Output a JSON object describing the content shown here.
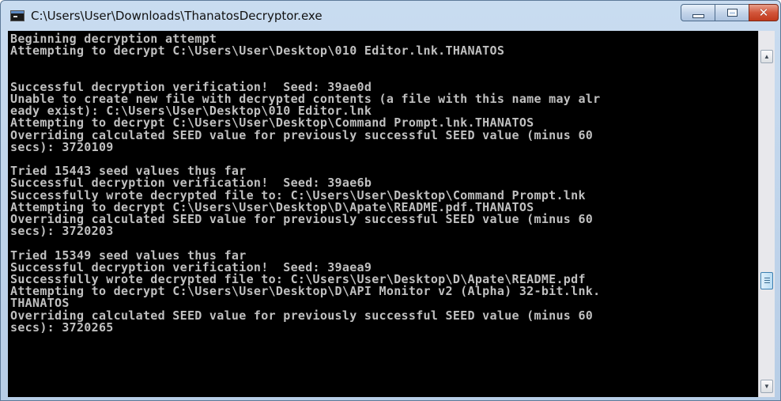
{
  "window": {
    "title": "C:\\Users\\User\\Downloads\\ThanatosDecryptor.exe",
    "icon": "console-app-icon",
    "controls": {
      "minimize": "minimize-icon",
      "maximize": "maximize-icon",
      "close": "✕"
    }
  },
  "console": {
    "background": "#000000",
    "foreground": "#c0c0c0",
    "lines": [
      "Beginning decryption attempt",
      "Attempting to decrypt C:\\Users\\User\\Desktop\\010 Editor.lnk.THANATOS",
      "",
      "",
      "Successful decryption verification!  Seed: 39ae0d",
      "Unable to create new file with decrypted contents (a file with this name may alr",
      "eady exist): C:\\Users\\User\\Desktop\\010 Editor.lnk",
      "Attempting to decrypt C:\\Users\\User\\Desktop\\Command Prompt.lnk.THANATOS",
      "Overriding calculated SEED value for previously successful SEED value (minus 60",
      "secs): 3720109",
      "",
      "Tried 15443 seed values thus far",
      "Successful decryption verification!  Seed: 39ae6b",
      "Successfully wrote decrypted file to: C:\\Users\\User\\Desktop\\Command Prompt.lnk",
      "Attempting to decrypt C:\\Users\\User\\Desktop\\D\\Apate\\README.pdf.THANATOS",
      "Overriding calculated SEED value for previously successful SEED value (minus 60",
      "secs): 3720203",
      "",
      "Tried 15349 seed values thus far",
      "Successful decryption verification!  Seed: 39aea9",
      "Successfully wrote decrypted file to: C:\\Users\\User\\Desktop\\D\\Apate\\README.pdf",
      "Attempting to decrypt C:\\Users\\User\\Desktop\\D\\API Monitor v2 (Alpha) 32-bit.lnk.",
      "THANATOS",
      "Overriding calculated SEED value for previously successful SEED value (minus 60",
      "secs): 3720265"
    ]
  },
  "scrollbar": {
    "up_icon": "▲",
    "down_icon": "▼",
    "position": 0.7
  }
}
